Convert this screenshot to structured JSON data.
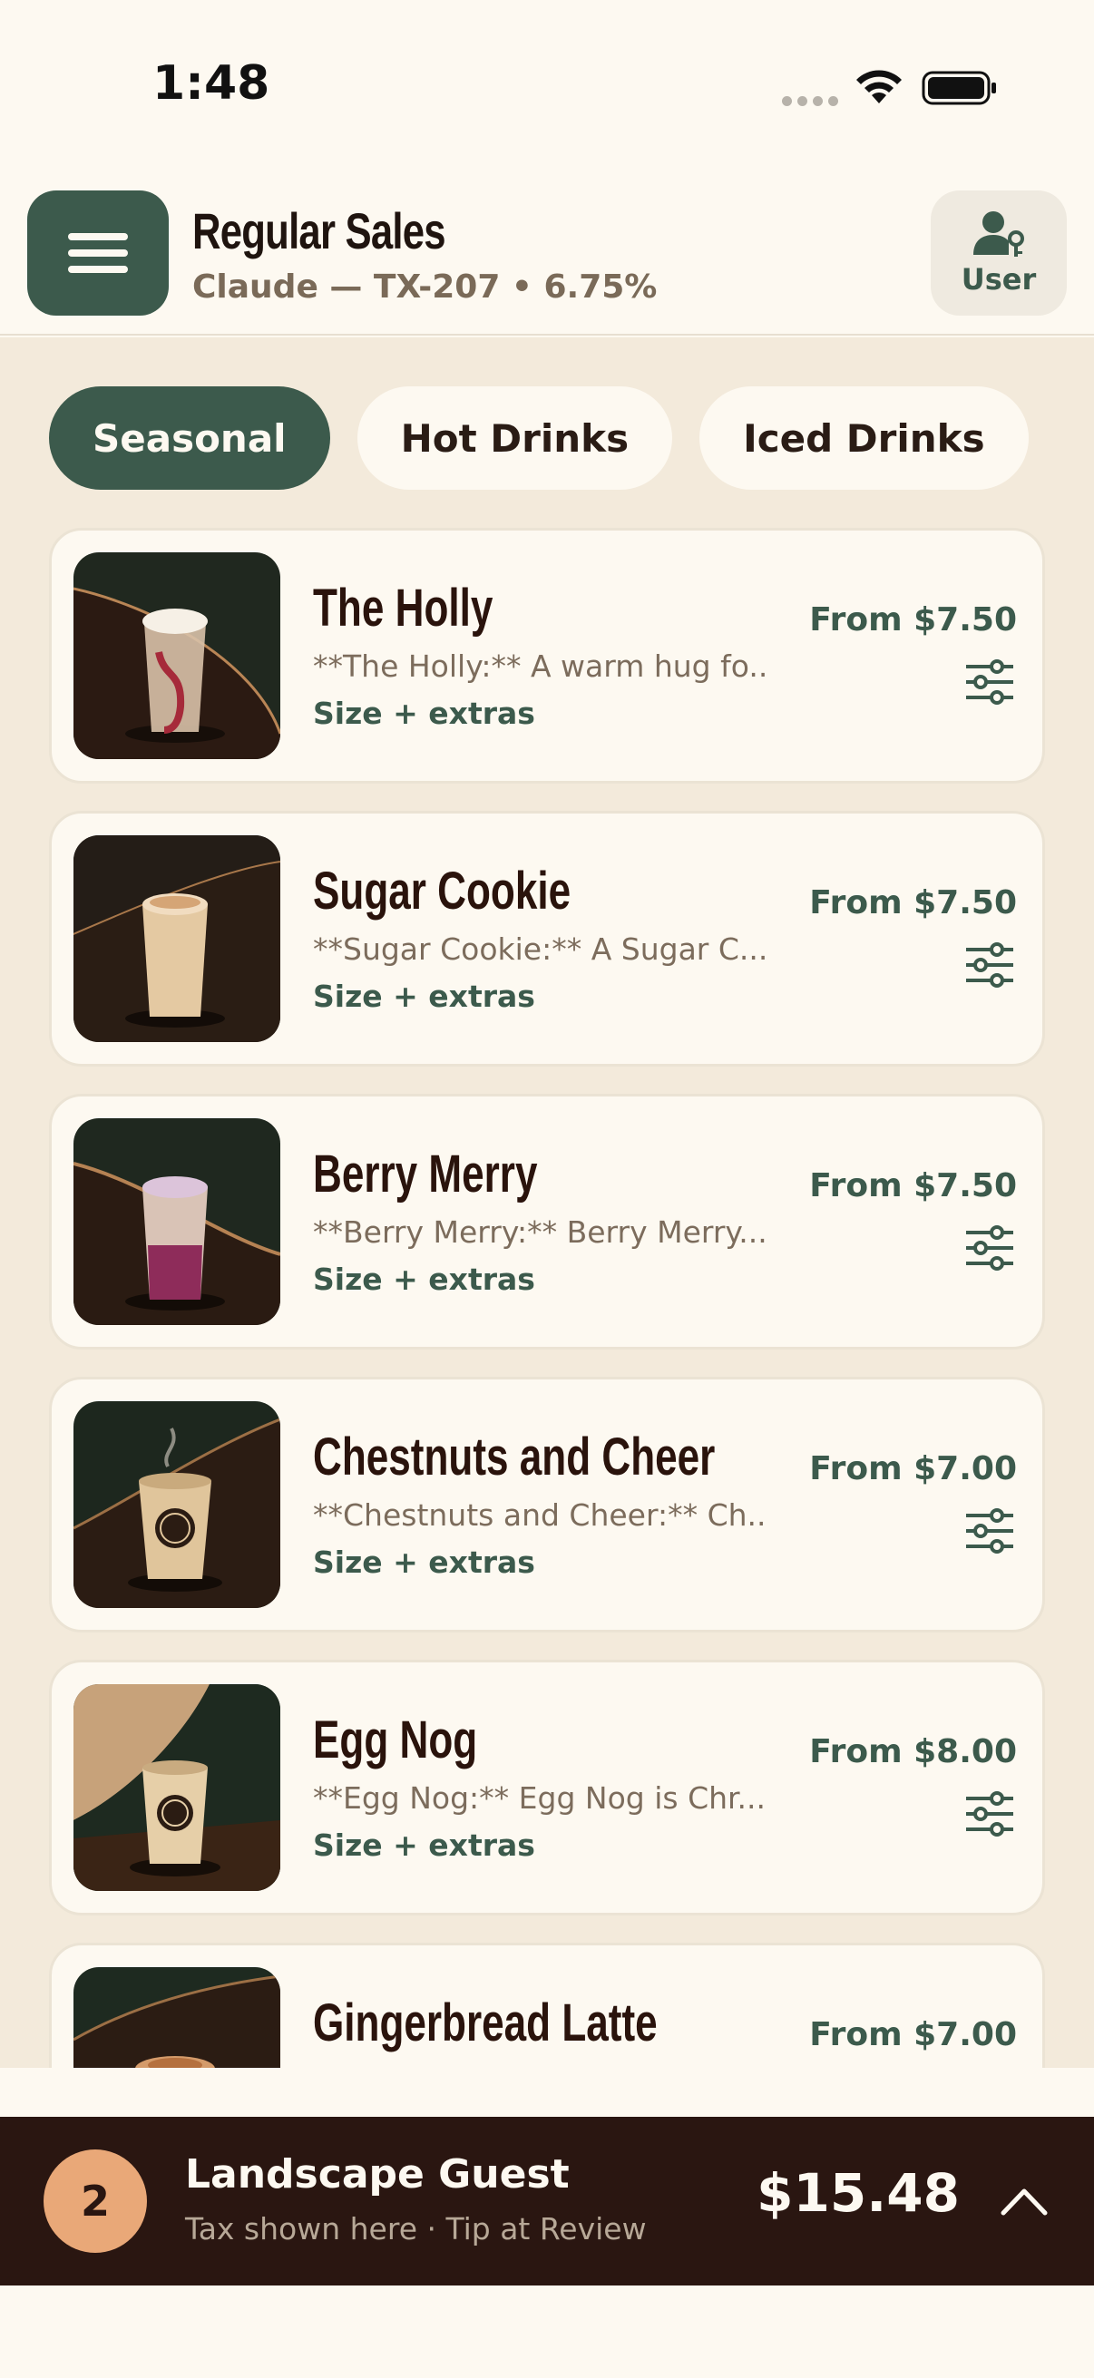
{
  "status_bar": {
    "time": "1:48"
  },
  "header": {
    "title": "Regular Sales",
    "subtitle": "Claude — TX-207  •  6.75%",
    "user_label": "User"
  },
  "tabs": [
    {
      "label": "Seasonal",
      "active": true
    },
    {
      "label": "Hot Drinks",
      "active": false
    },
    {
      "label": "Iced Drinks",
      "active": false
    },
    {
      "label": "",
      "active": false
    }
  ],
  "products": [
    {
      "name": "The Holly",
      "description": "**The Holly:** A warm hug fo...",
      "extras": "Size + extras",
      "price": "From $7.50",
      "image": "iced-drink-red-swirl"
    },
    {
      "name": "Sugar Cookie",
      "description": "**Sugar Cookie:** A Sugar C...",
      "extras": "Size + extras",
      "price": "From $7.50",
      "image": "iced-drink-cream"
    },
    {
      "name": "Berry Merry",
      "description": "**Berry Merry:** Berry Merry...",
      "extras": "Size + extras",
      "price": "From $7.50",
      "image": "iced-drink-berry"
    },
    {
      "name": "Chestnuts and Cheer",
      "description": "**Chestnuts and Cheer:** Ch...",
      "extras": "Size + extras",
      "price": "From $7.00",
      "image": "hot-cup-steam"
    },
    {
      "name": "Egg Nog",
      "description": "**Egg Nog:** Egg Nog is Chr...",
      "extras": "Size + extras",
      "price": "From $8.00",
      "image": "hot-cup"
    },
    {
      "name": "Gingerbread Latte",
      "description": "",
      "extras": "",
      "price": "From $7.00",
      "image": "hot-cup-foam"
    }
  ],
  "cart": {
    "count": "2",
    "guest": "Landscape Guest",
    "note": "Tax shown here · Tip at Review",
    "total": "$15.48"
  },
  "colors": {
    "brand_green": "#3c5a4c",
    "cart_bar": "#2a1611",
    "badge": "#e9a878",
    "background": "#f3eadb"
  }
}
